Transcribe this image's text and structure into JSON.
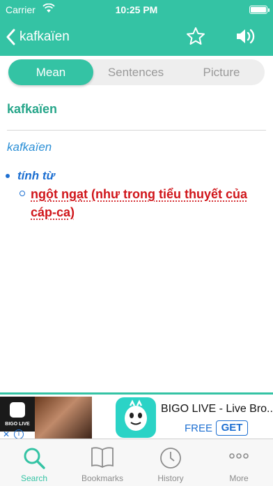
{
  "status_bar": {
    "carrier": "Carrier",
    "time": "10:25 PM"
  },
  "nav": {
    "back_label": "kafkaïen",
    "icons": [
      "back-chevron-icon",
      "star-icon",
      "speaker-icon"
    ]
  },
  "tabs": [
    {
      "label": "Mean",
      "active": true
    },
    {
      "label": "Sentences",
      "active": false
    },
    {
      "label": "Picture",
      "active": false
    }
  ],
  "entry": {
    "word": "kafkaïen",
    "phonetic": "kafkaïen",
    "part_of_speech": "tính từ",
    "meaning": "ngột ngạt (như trong tiểu thuyết của cáp-ca)"
  },
  "ad": {
    "thumb_text": "BIGO LIVE",
    "app_name": "BIGO LIVE - Live Bro...",
    "price": "FREE",
    "cta": "GET"
  },
  "tabbar": [
    {
      "label": "Search",
      "icon": "search-icon",
      "active": true
    },
    {
      "label": "Bookmarks",
      "icon": "book-icon",
      "active": false
    },
    {
      "label": "History",
      "icon": "clock-icon",
      "active": false
    },
    {
      "label": "More",
      "icon": "more-dots-icon",
      "active": false
    }
  ],
  "colors": {
    "accent": "#34c3a4",
    "headword": "#27a68a",
    "phonetic": "#2b8fd6",
    "pos": "#1d6fd1",
    "meaning": "#d0151a"
  }
}
